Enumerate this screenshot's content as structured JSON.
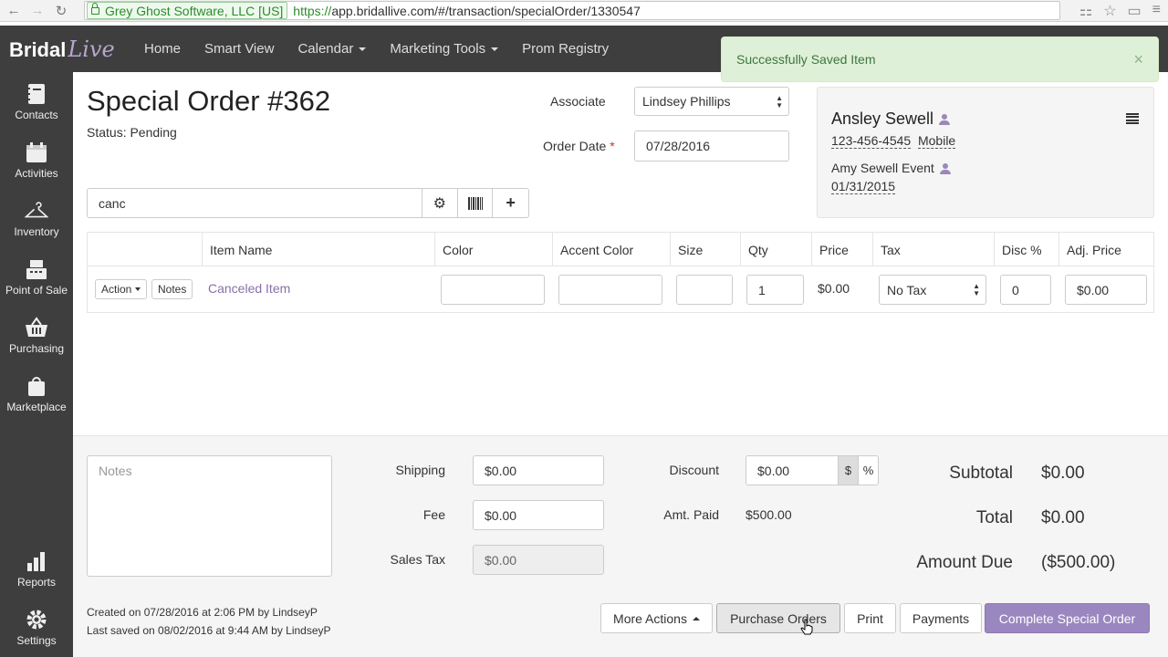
{
  "browser": {
    "ev_label": "Grey Ghost Software, LLC [US]",
    "url_scheme": "https://",
    "url_rest": "app.bridallive.com/#/transaction/specialOrder/1330547"
  },
  "app": {
    "logo_bridal": "Bridal",
    "logo_live": "Live",
    "nav": [
      "Home",
      "Smart View",
      "Calendar",
      "Marketing Tools",
      "Prom Registry"
    ],
    "accent_color": "#9b87c0"
  },
  "toast": {
    "message": "Successfully Saved Item"
  },
  "sidebar": {
    "items": [
      {
        "label": "Contacts",
        "icon": "contacts-icon"
      },
      {
        "label": "Activities",
        "icon": "calendar-icon"
      },
      {
        "label": "Inventory",
        "icon": "hanger-icon"
      },
      {
        "label": "Point of Sale",
        "icon": "register-icon"
      },
      {
        "label": "Purchasing",
        "icon": "basket-icon"
      },
      {
        "label": "Marketplace",
        "icon": "bag-icon"
      },
      {
        "label": "Reports",
        "icon": "bar-chart-icon"
      },
      {
        "label": "Settings",
        "icon": "gear-icon"
      }
    ]
  },
  "order": {
    "title": "Special Order #362",
    "status": "Status: Pending",
    "associate_label": "Associate",
    "associate_value": "Lindsey Phillips",
    "date_label": "Order Date",
    "date_value": "07/28/2016"
  },
  "customer": {
    "name": "Ansley Sewell",
    "phone": "123-456-4545",
    "phone_type": "Mobile",
    "event": "Amy Sewell Event",
    "event_date": "01/31/2015"
  },
  "search": {
    "value": "canc"
  },
  "table": {
    "headers": [
      "Item Name",
      "Color",
      "Accent Color",
      "Size",
      "Qty",
      "Price",
      "Tax",
      "Disc %",
      "Adj. Price"
    ],
    "row": {
      "action": "Action",
      "notes": "Notes",
      "item_name": "Canceled Item",
      "color": "",
      "accent_color": "",
      "size": "",
      "qty": "1",
      "price": "$0.00",
      "tax": "No Tax",
      "disc": "0",
      "adj_price": "$0.00"
    }
  },
  "footer": {
    "notes_placeholder": "Notes",
    "shipping_label": "Shipping",
    "shipping_value": "$0.00",
    "fee_label": "Fee",
    "fee_value": "$0.00",
    "sales_tax_label": "Sales Tax",
    "sales_tax_value": "$0.00",
    "discount_label": "Discount",
    "discount_value": "$0.00",
    "discount_dollar": "$",
    "discount_percent": "%",
    "amt_paid_label": "Amt. Paid",
    "amt_paid_value": "$500.00",
    "subtotal_label": "Subtotal",
    "subtotal_value": "$0.00",
    "total_label": "Total",
    "total_value": "$0.00",
    "amount_due_label": "Amount Due",
    "amount_due_value": "($500.00)",
    "created": "Created on 07/28/2016 at 2:06 PM by LindseyP",
    "saved": "Last saved on 08/02/2016 at 9:44 AM by LindseyP",
    "buttons": {
      "more_actions": "More Actions",
      "purchase_orders": "Purchase Orders",
      "print": "Print",
      "payments": "Payments",
      "complete": "Complete Special Order"
    }
  }
}
